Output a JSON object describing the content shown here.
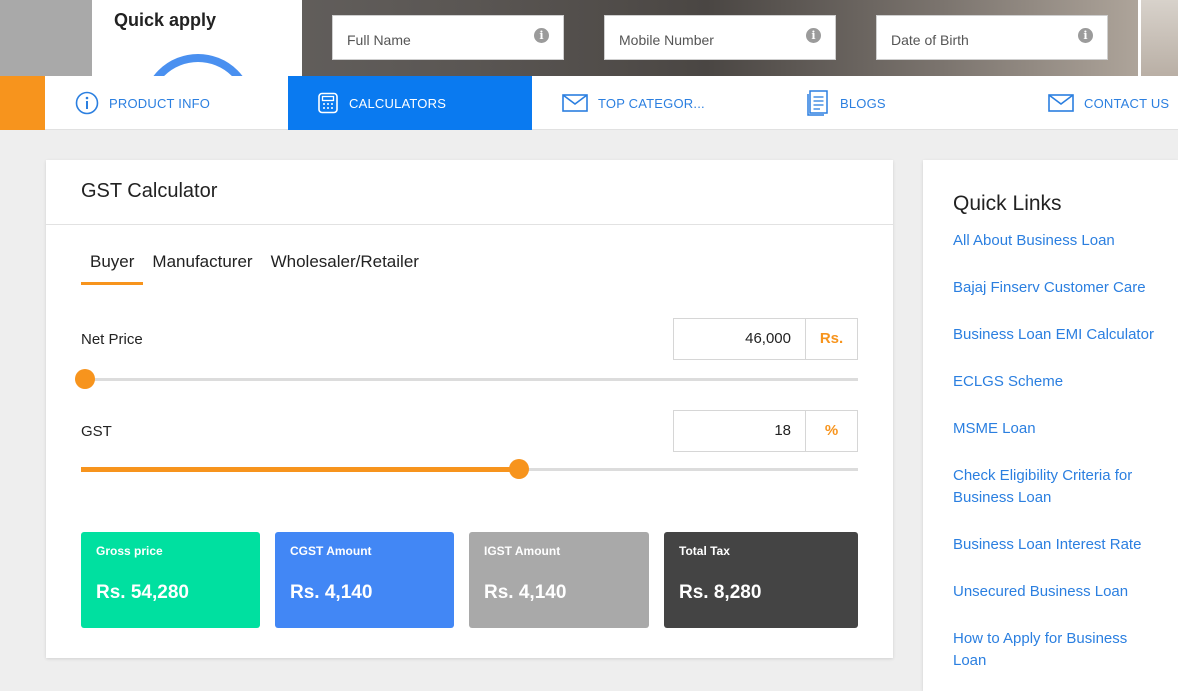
{
  "banner": {
    "quick_apply_title": "Quick apply",
    "fields": [
      {
        "placeholder": "Full Name"
      },
      {
        "placeholder": "Mobile Number"
      },
      {
        "placeholder": "Date of Birth"
      }
    ]
  },
  "nav": {
    "items": [
      {
        "label": "PRODUCT INFO",
        "icon": "info-icon"
      },
      {
        "label": "CALCULATORS",
        "icon": "calculator-icon",
        "active": true
      },
      {
        "label": "TOP CATEGOR...",
        "icon": "mail-icon"
      },
      {
        "label": "BLOGS",
        "icon": "document-icon"
      },
      {
        "label": "CONTACT US",
        "icon": "mail-icon"
      }
    ]
  },
  "calculator": {
    "title": "GST Calculator",
    "tabs": [
      "Buyer",
      "Manufacturer",
      "Wholesaler/Retailer"
    ],
    "active_tab": "Buyer",
    "net_price": {
      "label": "Net Price",
      "value": "46,000",
      "unit": "Rs.",
      "slider_fraction": 0.005
    },
    "gst": {
      "label": "GST",
      "value": "18",
      "unit": "%",
      "slider_fraction": 0.564
    },
    "results": [
      {
        "label": "Gross price",
        "value": "Rs. 54,280",
        "color": "#00e0a0"
      },
      {
        "label": "CGST Amount",
        "value": "Rs. 4,140",
        "color": "#4287f5"
      },
      {
        "label": "IGST Amount",
        "value": "Rs. 4,140",
        "color": "#a9a9a9"
      },
      {
        "label": "Total Tax",
        "value": "Rs. 8,280",
        "color": "#444444"
      }
    ]
  },
  "quick_links": {
    "title": "Quick Links",
    "links": [
      "All About Business Loan",
      "Bajaj Finserv Customer Care",
      "Business Loan EMI Calculator",
      "ECLGS Scheme",
      "MSME Loan",
      "Check Eligibility Criteria for Business Loan",
      "Business Loan Interest Rate",
      "Unsecured Business Loan",
      "How to Apply for Business Loan"
    ]
  },
  "colors": {
    "accent": "#f7941d",
    "primary": "#0a7af0",
    "link": "#2b7fe0"
  }
}
